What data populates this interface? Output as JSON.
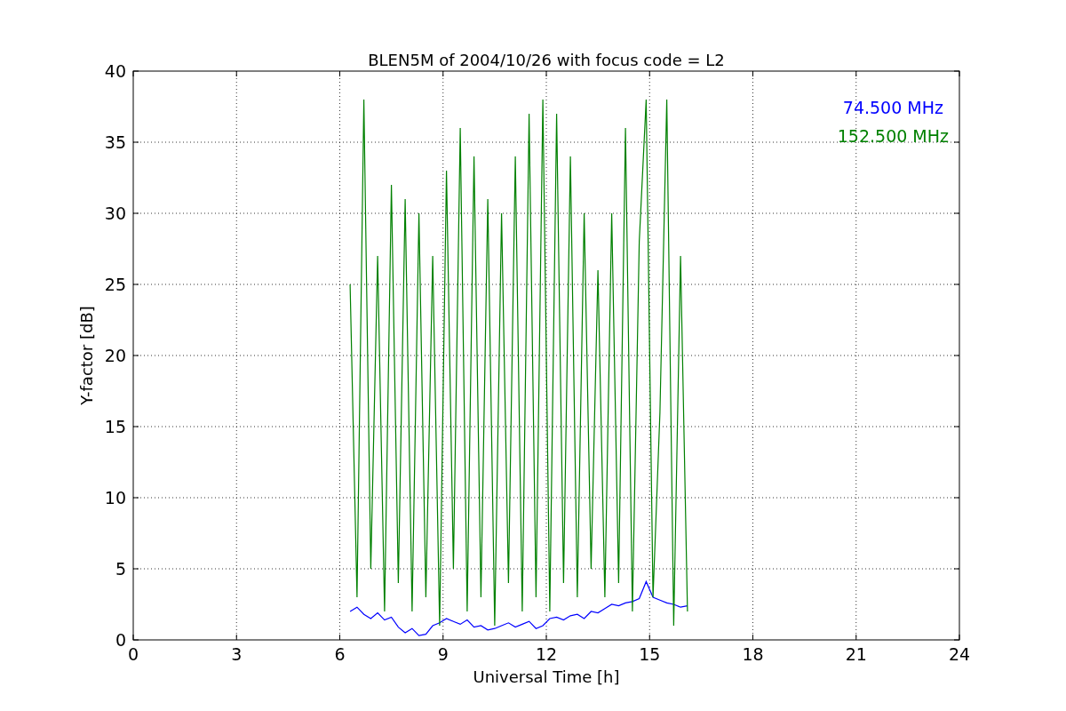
{
  "figure": {
    "chart_data": {
      "type": "line",
      "title": "BLEN5M of 2004/10/26 with focus code = L2",
      "xlabel": "Universal Time [h]",
      "ylabel": "Y-factor [dB]",
      "x": [
        6.3,
        6.5,
        6.7,
        6.9,
        7.1,
        7.3,
        7.5,
        7.7,
        7.9,
        8.1,
        8.3,
        8.5,
        8.7,
        8.9,
        9.1,
        9.3,
        9.5,
        9.7,
        9.9,
        10.1,
        10.3,
        10.5,
        10.7,
        10.9,
        11.1,
        11.3,
        11.5,
        11.7,
        11.9,
        12.1,
        12.3,
        12.5,
        12.7,
        12.9,
        13.1,
        13.3,
        13.5,
        13.7,
        13.9,
        14.1,
        14.3,
        14.5,
        14.7,
        14.9,
        15.1,
        15.3,
        15.5,
        15.7,
        15.9,
        16.1
      ],
      "series": [
        {
          "name": "74.500 MHz",
          "color": "#0000ff",
          "values": [
            2,
            2.3,
            1.8,
            1.5,
            1.9,
            1.4,
            1.6,
            0.9,
            0.5,
            0.8,
            0.3,
            0.4,
            1.0,
            1.2,
            1.5,
            1.3,
            1.1,
            1.4,
            0.9,
            1.0,
            0.7,
            0.8,
            1.0,
            1.2,
            0.9,
            1.1,
            1.3,
            0.8,
            1.0,
            1.5,
            1.6,
            1.4,
            1.7,
            1.8,
            1.5,
            2.0,
            1.9,
            2.2,
            2.5,
            2.4,
            2.6,
            2.7,
            2.9,
            4.1,
            3.0,
            2.8,
            2.6,
            2.5,
            2.3,
            2.4
          ]
        },
        {
          "name": "152.500 MHz",
          "color": "#008000",
          "values": [
            25,
            3,
            38,
            5,
            27,
            2,
            32,
            4,
            31,
            2,
            30,
            3,
            27,
            1,
            33,
            5,
            36,
            2,
            34,
            3,
            31,
            1,
            30,
            4,
            34,
            2,
            37,
            3,
            38,
            2,
            37,
            4,
            34,
            3,
            30,
            5,
            26,
            3,
            30,
            4,
            36,
            2,
            28,
            38,
            3,
            16,
            38,
            1,
            27,
            2
          ]
        }
      ],
      "grid": true,
      "xlim": [
        0,
        24
      ],
      "ylim": [
        0,
        40
      ],
      "xticks": [
        0,
        3,
        6,
        9,
        12,
        15,
        18,
        21,
        24
      ],
      "yticks": [
        0,
        5,
        10,
        15,
        20,
        25,
        30,
        35,
        40
      ]
    }
  }
}
